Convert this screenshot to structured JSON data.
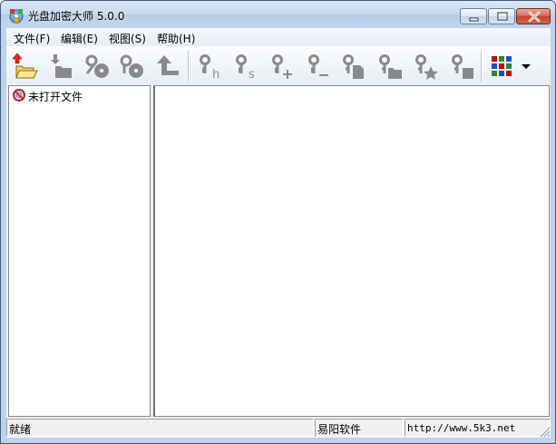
{
  "window": {
    "title": "光盘加密大师 5.0.0",
    "app_icon": "cd-lock-app-icon",
    "controls": [
      "minimize-icon",
      "maximize-icon",
      "close-icon"
    ]
  },
  "menu": [
    {
      "label": "文件(F)"
    },
    {
      "label": "编辑(E)"
    },
    {
      "label": "视图(S)"
    },
    {
      "label": "帮助(H)"
    }
  ],
  "toolbar": {
    "buttons": [
      {
        "icon": "open-folder-icon"
      },
      {
        "icon": "save-down-icon"
      },
      {
        "icon": "key-disc-icon"
      },
      {
        "icon": "key-disc-alt-icon"
      },
      {
        "icon": "up-level-icon"
      },
      {
        "icon": "key-hide-icon"
      },
      {
        "icon": "key-s-icon"
      },
      {
        "icon": "key-plus-icon"
      },
      {
        "icon": "key-minus-icon"
      },
      {
        "icon": "key-file-icon"
      },
      {
        "icon": "key-folder-icon"
      },
      {
        "icon": "key-star-icon"
      },
      {
        "icon": "key-square-icon"
      },
      {
        "icon": "view-grid-icon"
      },
      {
        "icon": "dropdown-arrow-icon"
      }
    ],
    "grid_colors": [
      "#c00000",
      "#2a8a2a",
      "#1f4fbf",
      "#1f4fbf",
      "#c00000",
      "#2a8a2a",
      "#2a8a2a",
      "#1f4fbf",
      "#c00000"
    ]
  },
  "tree": {
    "items": [
      {
        "label": "未打开文件",
        "icon": "no-disc-icon"
      }
    ]
  },
  "statusbar": {
    "status": "就绪",
    "publisher": "易阳软件",
    "url": "http://www.5k3.net"
  },
  "colors": {
    "titlebar": "#c4d8ef",
    "close_button": "#c4432d",
    "toolbar_icon_gray": "#8a8a8a"
  }
}
